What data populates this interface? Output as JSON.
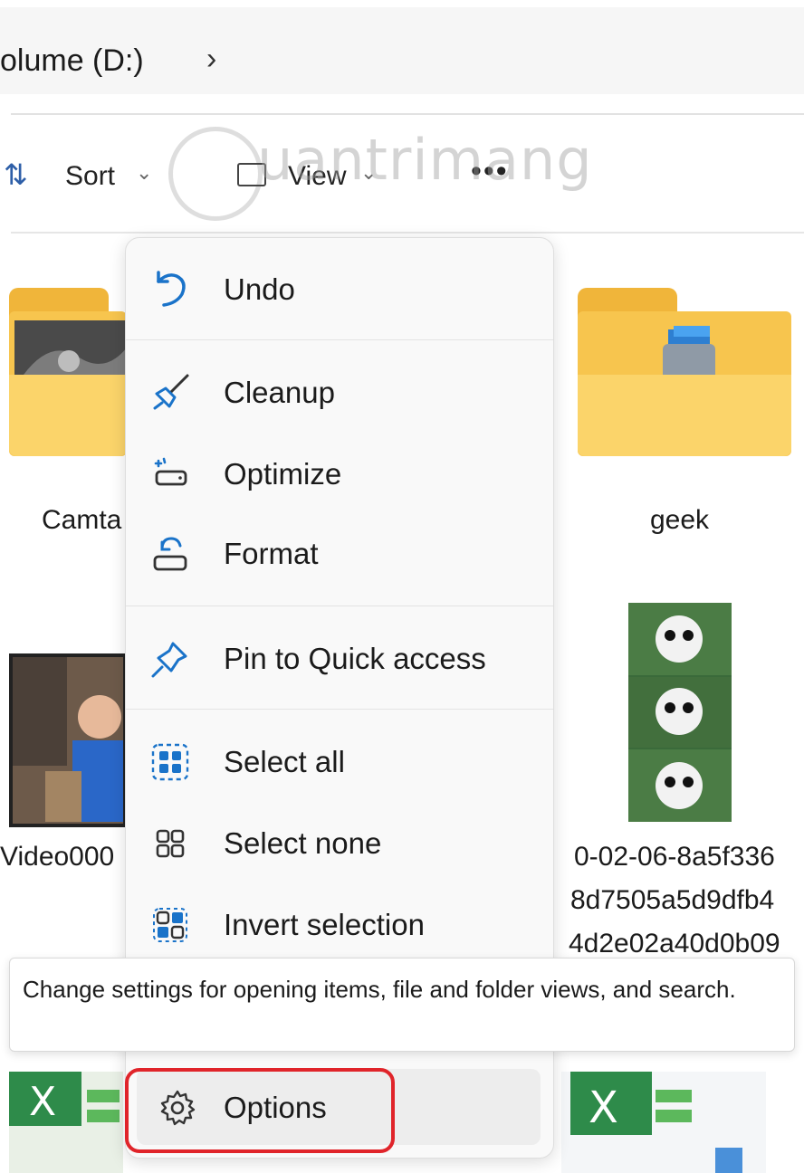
{
  "address": {
    "path_text": "olume (D:)",
    "chevron": "›"
  },
  "toolbar": {
    "sort_icon": "⇅",
    "sort_label": "Sort",
    "dropdown_chevron": "⌄",
    "view_label": "View",
    "more_label": "•••"
  },
  "watermark": {
    "text": "uantrimang"
  },
  "files": [
    {
      "label": "Camta"
    },
    {
      "label": "geek"
    },
    {
      "label": "Video000"
    },
    {
      "label_lines": [
        "0-02-06-8a5f336",
        "8d7505a5d9dfb4",
        "4d2e02a40d0b09"
      ]
    }
  ],
  "menu": {
    "items": [
      {
        "label": "Undo",
        "icon": "undo-icon"
      },
      {
        "label": "Cleanup",
        "icon": "broom-icon"
      },
      {
        "label": "Optimize",
        "icon": "optimize-drive-icon"
      },
      {
        "label": "Format",
        "icon": "format-drive-icon"
      },
      {
        "label": "Pin to Quick access",
        "icon": "pin-icon"
      },
      {
        "label": "Select all",
        "icon": "select-all-icon"
      },
      {
        "label": "Select none",
        "icon": "select-none-icon"
      },
      {
        "label": "Invert selection",
        "icon": "invert-selection-icon"
      },
      {
        "label": "Options",
        "icon": "gear-icon"
      }
    ],
    "accent_color": "#1a73c9"
  },
  "tooltip": {
    "text": "Change settings for opening items, file and folder views, and search."
  },
  "highlight_color": "#e0242a"
}
